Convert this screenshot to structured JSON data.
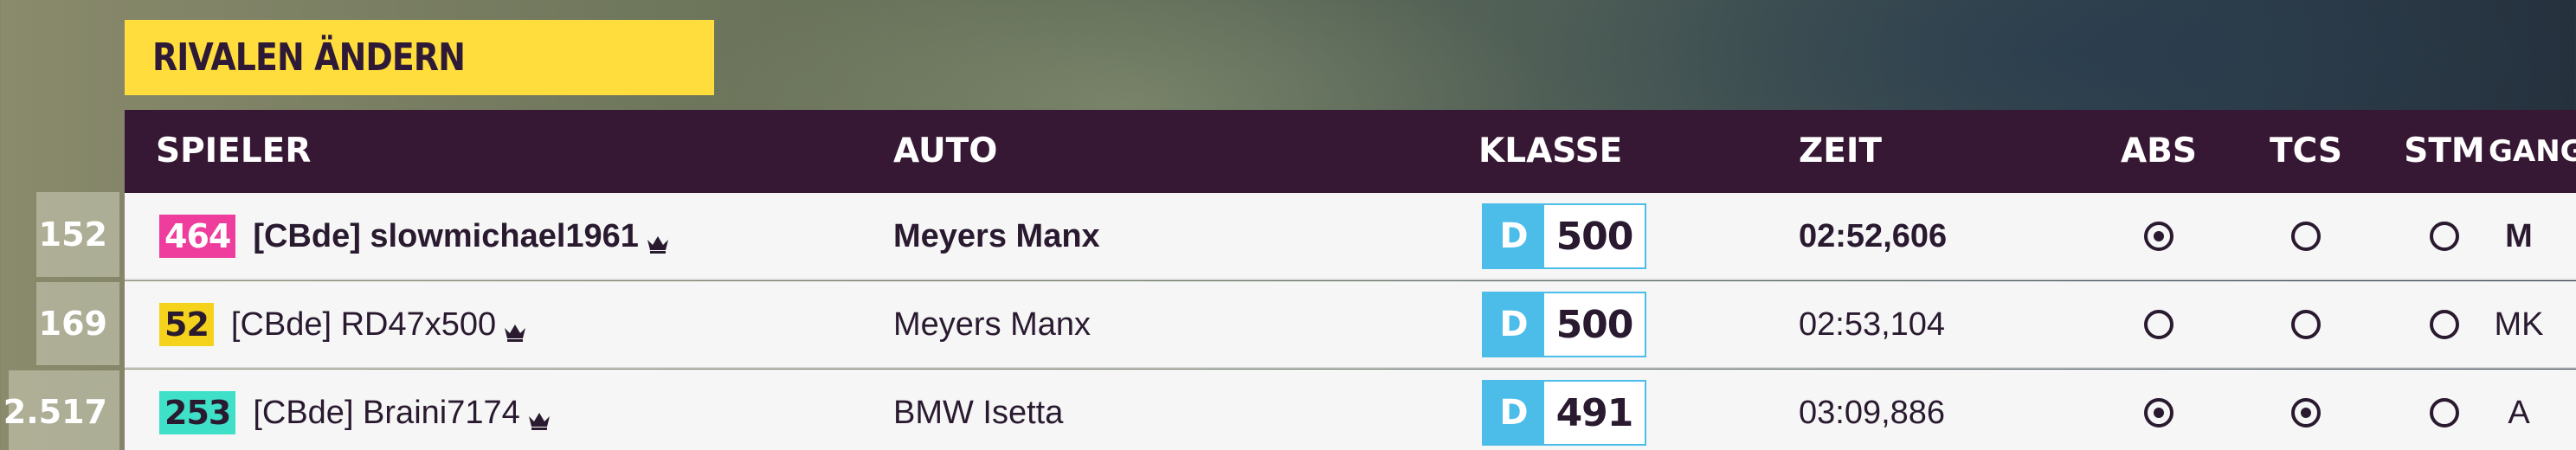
{
  "header": {
    "title": "RIVALEN ÄNDERN"
  },
  "columns": {
    "player": "SPIELER",
    "car": "AUTO",
    "class": "KLASSE",
    "time": "ZEIT",
    "abs": "ABS",
    "tcs": "TCS",
    "stm": "STM",
    "gear": "GANG"
  },
  "ranks": [
    "152",
    "169",
    "2.517"
  ],
  "rows": [
    {
      "level": "464",
      "level_color": "#ee3d9c",
      "level_text_color": "#ffffff",
      "player": "[CBde] slowmichael1961",
      "crown_icon": "crown-icon",
      "car": "Meyers Manx",
      "class_letter": "D",
      "pi": "500",
      "time": "02:52,606",
      "abs": true,
      "tcs": false,
      "stm": false,
      "gear": "M",
      "highlighted": true
    },
    {
      "level": "52",
      "level_color": "#f5d21c",
      "level_text_color": "#2a1a30",
      "player": "[CBde] RD47x500",
      "crown_icon": "crown-icon",
      "car": "Meyers Manx",
      "class_letter": "D",
      "pi": "500",
      "time": "02:53,104",
      "abs": false,
      "tcs": false,
      "stm": false,
      "gear": "MK",
      "highlighted": false
    },
    {
      "level": "253",
      "level_color": "#3fe0c8",
      "level_text_color": "#2a1a30",
      "player": "[CBde] Braini7174",
      "crown_icon": "crown-icon",
      "car": "BMW Isetta",
      "class_letter": "D",
      "pi": "491",
      "time": "03:09,886",
      "abs": true,
      "tcs": true,
      "stm": false,
      "gear": "A",
      "highlighted": false
    }
  ],
  "colors": {
    "banner": "#ffdd3c",
    "header_bg": "#371834",
    "class_d": "#4cbde9"
  }
}
